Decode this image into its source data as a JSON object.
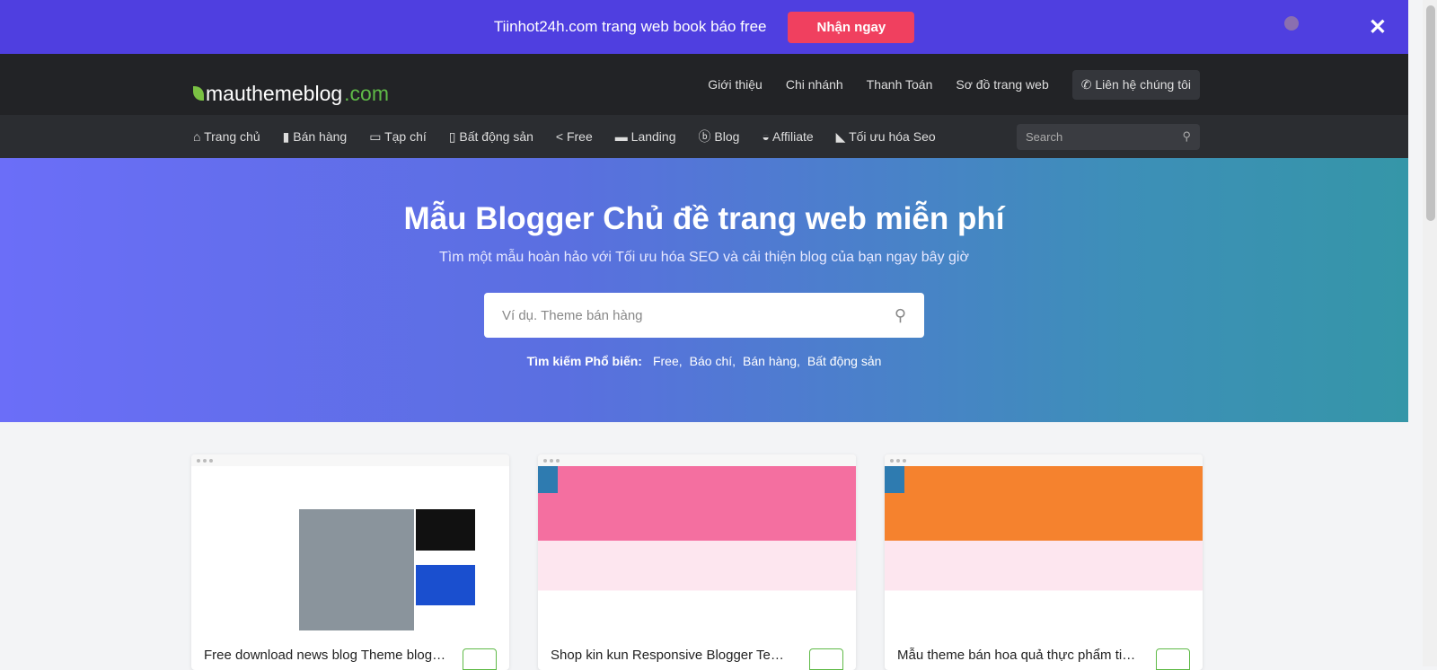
{
  "promo": {
    "text": "Tiinhot24h.com trang web book báo free",
    "button": "Nhận ngay",
    "close": "✕"
  },
  "logo": {
    "main": "mauthemeblog",
    "tld": ".com"
  },
  "topnav": [
    "Giới thiệu",
    "Chi nhánh",
    "Thanh Toán",
    "Sơ đồ trang web"
  ],
  "contact": "Liên hệ chúng tôi",
  "menu": [
    {
      "icon": "home-icon",
      "glyph": "⌂",
      "label": "Trang chủ"
    },
    {
      "icon": "bag-icon",
      "glyph": "▮",
      "label": "Bán hàng"
    },
    {
      "icon": "newspaper-icon",
      "glyph": "▭",
      "label": "Tạp chí"
    },
    {
      "icon": "building-icon",
      "glyph": "▯",
      "label": "Bất động sản"
    },
    {
      "icon": "share-icon",
      "glyph": "<",
      "label": "Free"
    },
    {
      "icon": "landing-icon",
      "glyph": "▬",
      "label": "Landing"
    },
    {
      "icon": "blogger-icon",
      "glyph": "ⓑ",
      "label": "Blog"
    },
    {
      "icon": "affiliate-icon",
      "glyph": "◒",
      "label": "Affiliate"
    },
    {
      "icon": "seo-icon",
      "glyph": "◣",
      "label": "Tối ưu hóa Seo"
    }
  ],
  "search": {
    "placeholder": "Search"
  },
  "hero": {
    "title": "Mẫu Blogger Chủ đề trang web miễn phí",
    "subtitle": "Tìm một mẫu hoàn hảo với Tối ưu hóa SEO và cải thiện blog của bạn ngay bây giờ",
    "placeholder": "Ví dụ. Theme bán hàng",
    "popular_label": "Tìm kiếm Phổ biến:",
    "popular": [
      "Free,",
      "Báo chí,",
      "Bán hàng,",
      "Bất động sản"
    ]
  },
  "cards": [
    {
      "title": "Free download news blog Theme blogspot",
      "theme": "#ffffff"
    },
    {
      "title": "Shop kin kun Responsive Blogger Template",
      "theme": "#f46fa0"
    },
    {
      "title": "Mẫu theme bán hoa quả thực phẩm tiêu chuẩn",
      "theme": "#f5822e"
    }
  ]
}
